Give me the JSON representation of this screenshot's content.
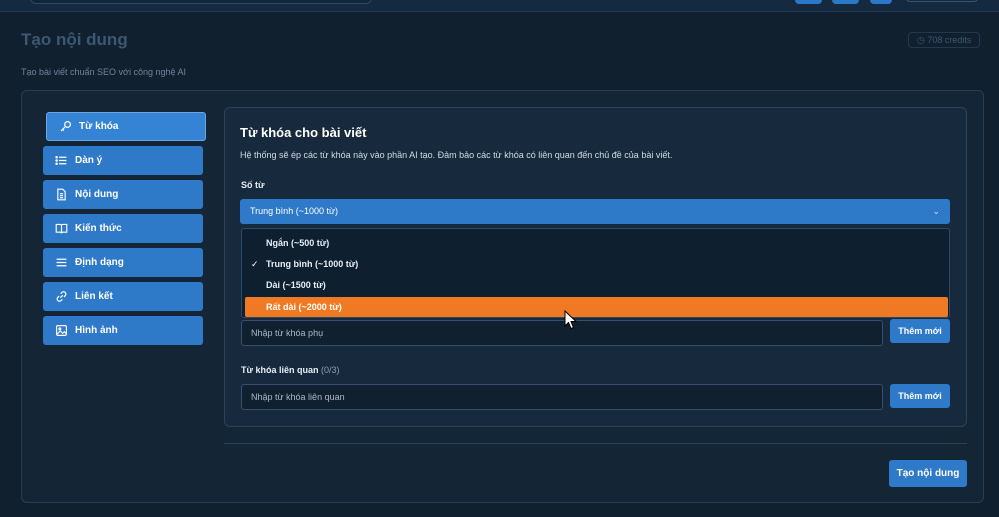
{
  "header": {
    "title": "Tạo nội dung",
    "subtitle": "Tạo bài viết chuẩn SEO với công nghệ AI",
    "credits": "708 credits"
  },
  "sidebar": {
    "items": [
      {
        "label": "Từ khóa",
        "icon": "key-icon"
      },
      {
        "label": "Dàn ý",
        "icon": "list-icon"
      },
      {
        "label": "Nội dung",
        "icon": "document-icon"
      },
      {
        "label": "Kiến thức",
        "icon": "book-icon"
      },
      {
        "label": "Định dạng",
        "icon": "menu-lines-icon"
      },
      {
        "label": "Liên kết",
        "icon": "link-icon"
      },
      {
        "label": "Hình ảnh",
        "icon": "image-icon"
      }
    ],
    "active_index": 0
  },
  "panel": {
    "title": "Từ khóa cho bài viết",
    "description": "Hệ thống sẽ ép các từ khóa này vào phần AI tạo. Đảm bảo các từ khóa có liên quan đến chủ đề của bài viết.",
    "word_count": {
      "label": "Số từ",
      "selected": "Trung bình (~1000 từ)",
      "options": [
        "Ngắn (~500 từ)",
        "Trung bình (~1000 từ)",
        "Dài (~1500 từ)",
        "Rất dài (~2000 từ)"
      ],
      "checked_index": 1,
      "hovered_index": 3
    },
    "secondary_keywords": {
      "placeholder": "Nhập từ khóa phụ",
      "add_label": "Thêm mới"
    },
    "related_keywords": {
      "label": "Từ khóa liên quan",
      "count": "(0/3)",
      "placeholder": "Nhập từ khóa liên quan",
      "add_label": "Thêm mới"
    }
  },
  "footer": {
    "submit_label": "Tạo nội dung"
  },
  "colors": {
    "accent": "#2f79c9",
    "highlight": "#f07a24",
    "background": "#10202f"
  }
}
